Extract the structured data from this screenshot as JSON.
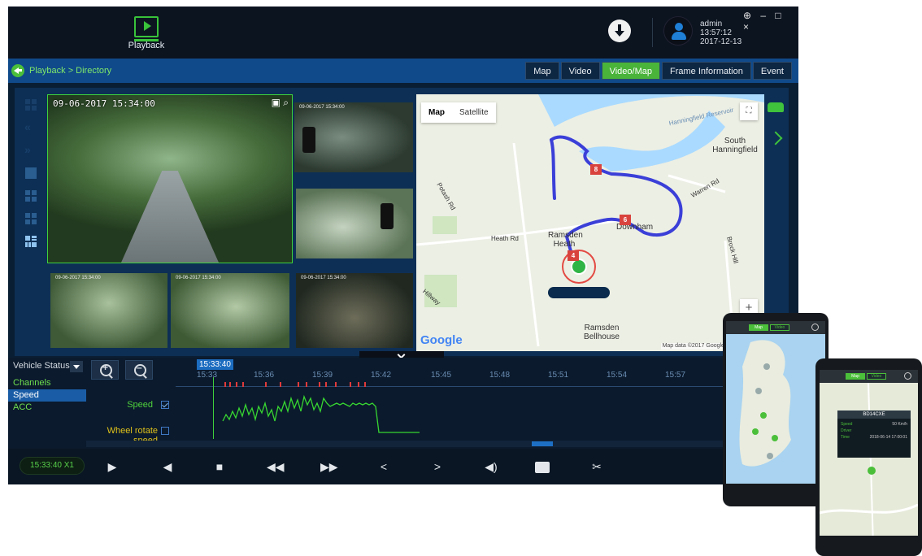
{
  "topbar": {
    "playback_label": "Playback",
    "user": {
      "name": "admin",
      "time": "13:57:12",
      "date": "2017-12-13"
    },
    "window_controls": "⊕ – □ ×"
  },
  "nav": {
    "breadcrumb": "Playback > Directory",
    "tabs": [
      {
        "label": "Map",
        "active": false
      },
      {
        "label": "Video",
        "active": false
      },
      {
        "label": "Video/Map",
        "active": true
      },
      {
        "label": "Frame Information",
        "active": false
      },
      {
        "label": "Event",
        "active": false
      }
    ]
  },
  "video": {
    "main_timestamp": "09-06-2017 15:34:00",
    "thumb_timestamp": "09-06-2017 15:34:00"
  },
  "map": {
    "type_map": "Map",
    "type_satellite": "Satellite",
    "places": [
      "Hanningfield Reservoir",
      "South Hanningfield",
      "Ramsden Heath",
      "Downham",
      "Ramsden Bellhouse",
      "Heath Rd",
      "Potash Rd",
      "Hillway",
      "Warren Rd",
      "Brock Hill"
    ],
    "markers": [
      "8",
      "6",
      "4"
    ],
    "google": "Google",
    "attribution": "Map data ©2017 Google   500 m ⎯⎯⎯   Te"
  },
  "timeline": {
    "vehicle_status": "Vehicle Status",
    "params": [
      "Channels",
      "Speed",
      "ACC"
    ],
    "metric_speed": "Speed",
    "metric_wheel": "Wheel rotate speed",
    "cursor_time": "15:33:40",
    "ticks": [
      "15:33",
      "15:36",
      "15:39",
      "15:42",
      "15:45",
      "15:48",
      "15:51",
      "15:54",
      "15:57"
    ]
  },
  "controls": {
    "clock": "15:33:40   X1"
  },
  "phone2": {
    "plate": "BD14CXE",
    "rows": [
      {
        "k": "Speed",
        "v": "50 Km/h"
      },
      {
        "k": "Driver",
        "v": ""
      },
      {
        "k": "Time",
        "v": "2018-06-14 17:00:01"
      }
    ]
  },
  "phone_tabs": {
    "map": "Map",
    "video": "Video"
  },
  "colors": {
    "accent": "#49b33a",
    "nav": "#104a8a",
    "route": "#3b3fd8",
    "graph": "#37d631"
  }
}
